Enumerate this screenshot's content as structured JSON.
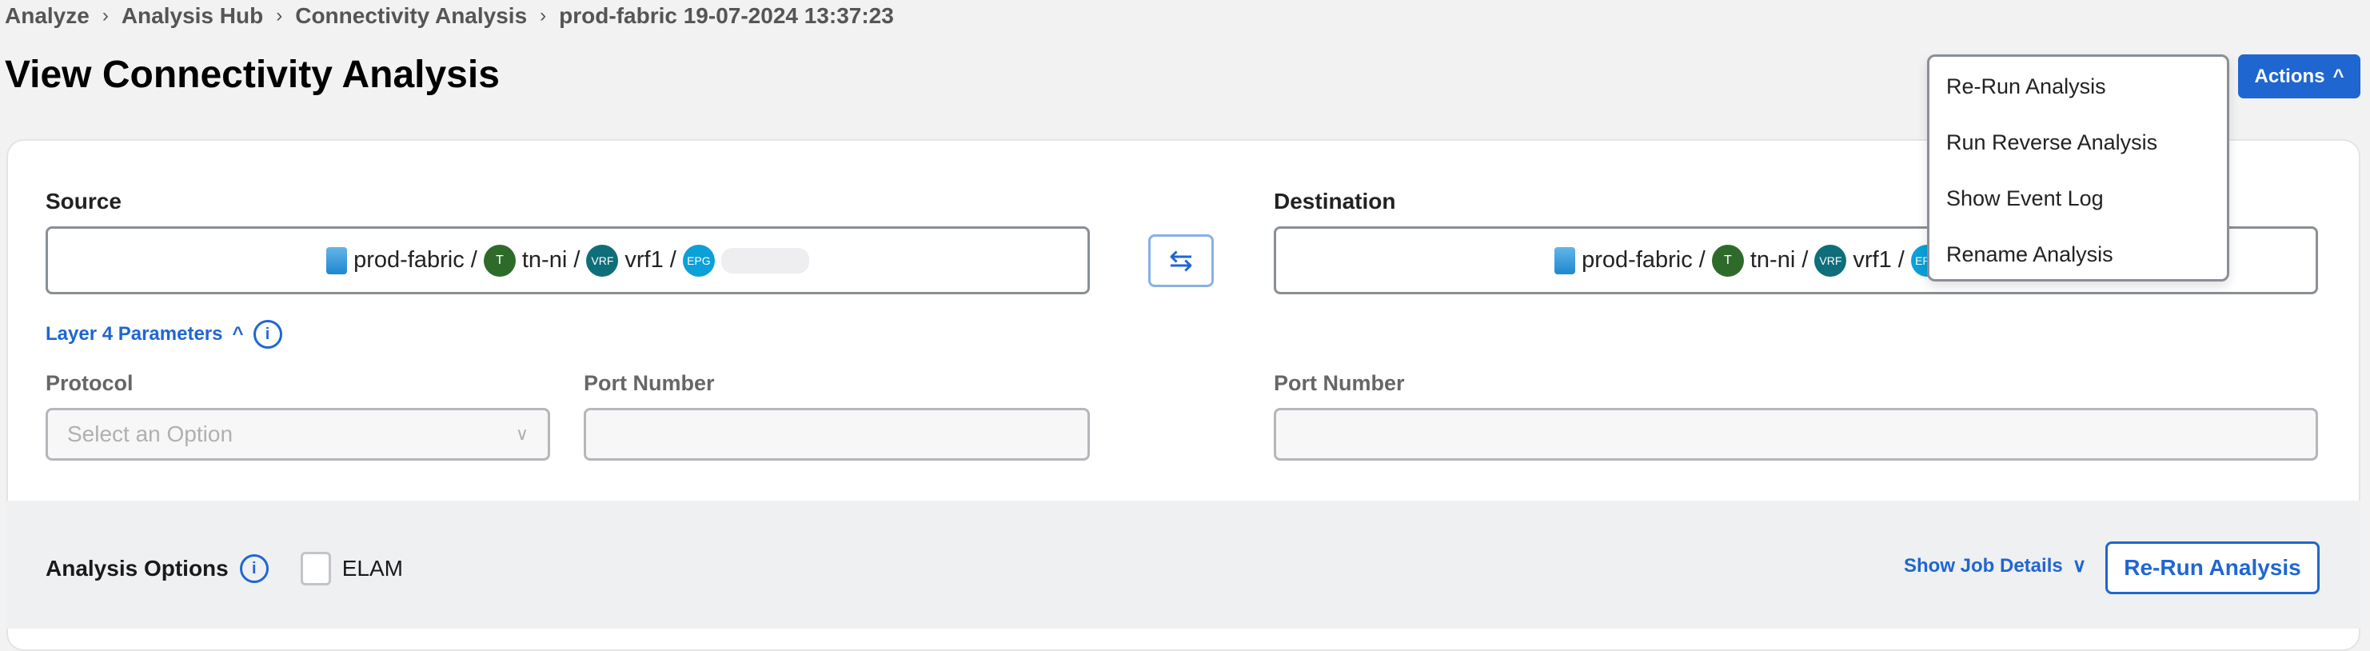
{
  "breadcrumb": [
    "Analyze",
    "Analysis Hub",
    "Connectivity Analysis",
    "prod-fabric 19-07-2024 13:37:23"
  ],
  "breadcrumb_separator": "›",
  "page_title": "View Connectivity Analysis",
  "actions": {
    "label": "Actions",
    "menu": [
      "Re-Run Analysis",
      "Run Reverse Analysis",
      "Show Event Log",
      "Rename Analysis"
    ]
  },
  "source": {
    "label": "Source",
    "fabric": "prod-fabric /",
    "tenant_badge": "T",
    "tenant": "tn-ni /",
    "vrf_badge": "VRF",
    "vrf": "vrf1 /",
    "epg_badge": "EPG"
  },
  "destination": {
    "label": "Destination",
    "fabric": "prod-fabric /",
    "tenant_badge": "T",
    "tenant": "tn-ni /",
    "vrf_badge": "VRF",
    "vrf": "vrf1 /",
    "epg_badge": "EPG"
  },
  "layer4": {
    "label": "Layer 4 Parameters",
    "protocol_label": "Protocol",
    "protocol_placeholder": "Select an Option",
    "src_port_label": "Port Number",
    "dst_port_label": "Port Number",
    "src_port_value": "",
    "dst_port_value": ""
  },
  "analysis_options": {
    "label": "Analysis Options",
    "elam_label": "ELAM",
    "elam_checked": false,
    "show_job_details": "Show Job Details",
    "rerun_label": "Re-Run Analysis"
  },
  "colors": {
    "primary": "#1f66d1",
    "tenant": "#2e6b2a",
    "vrf": "#0e6e7a",
    "epg": "#0aa0d8"
  }
}
